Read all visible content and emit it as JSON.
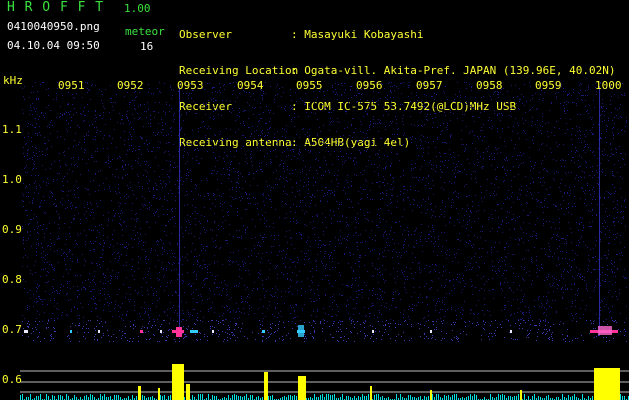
{
  "app": {
    "name": "H R O F F T",
    "version": "1.00",
    "filename": "0410040950.png",
    "datetime": "04.10.04 09:50",
    "meteor_label": "meteor",
    "meteor_count": "16"
  },
  "info": [
    {
      "key": "Observer",
      "value": ": Masayuki Kobayashi"
    },
    {
      "key": "Receiving Location",
      "value": ": Ogata-vill. Akita-Pref. JAPAN (139.96E, 40.02N)"
    },
    {
      "key": "Receiver",
      "value": ": ICOM IC-575 53.7492(@LCD)MHz USB"
    },
    {
      "key": "Receiving antenna",
      "value": ": A504HB(yagi 4el)"
    }
  ],
  "axis": {
    "unit": "kHz",
    "time_ticks": [
      "0951",
      "0952",
      "0953",
      "0954",
      "0955",
      "0956",
      "0957",
      "0958",
      "0959",
      "1000"
    ],
    "freq_ticks": [
      "1.1",
      "1.0",
      "0.9",
      "0.8",
      "0.7",
      "0.6"
    ]
  },
  "colors": {
    "background": "#000000",
    "text_green": "#39e13f",
    "text_white": "#ffffff",
    "tick_yellow": "#ffff33",
    "noise_blue": "#1a1a7a",
    "echo_white": "#e8e8ff",
    "echo_magenta": "#ff3399",
    "echo_cyan": "#33ccff",
    "level_yellow": "#ffff00",
    "level_cyan": "#00e0e0"
  }
}
